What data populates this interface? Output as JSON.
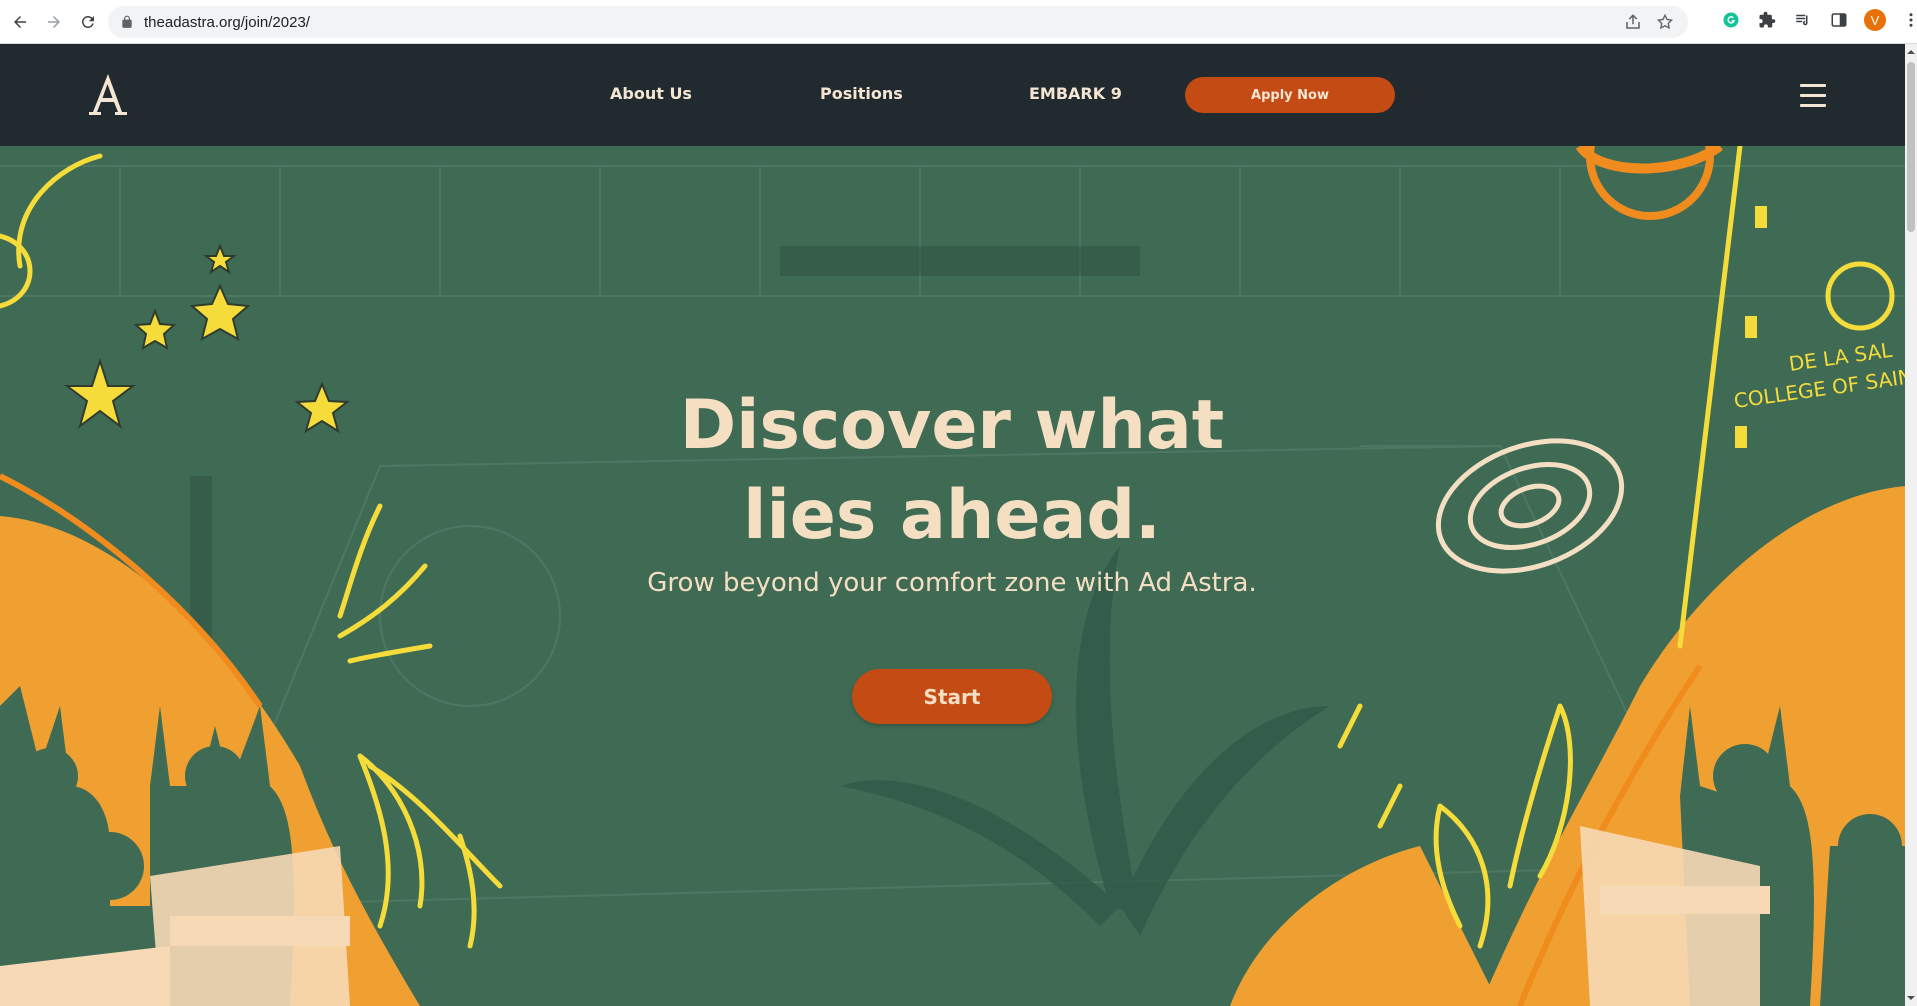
{
  "browser": {
    "url": "theadastra.org/join/2023/",
    "profile_initial": "V",
    "icons": [
      "back-icon",
      "forward-icon",
      "reload-icon",
      "lock-icon",
      "share-icon",
      "bookmark-star-icon",
      "grammarly-icon",
      "extensions-puzzle-icon",
      "media-queue-icon",
      "side-panel-icon",
      "kebab-menu-icon"
    ]
  },
  "site": {
    "logo_letter": "A",
    "nav": {
      "about": "About Us",
      "positions": "Positions",
      "embark": "EMBARK 9",
      "apply": "Apply Now"
    },
    "hero": {
      "title_line1": "Discover what",
      "title_line2": "lies ahead.",
      "subtitle": "Grow beyond your comfort zone with Ad Astra.",
      "cta": "Start",
      "sign_text_1": "DE LA SAL",
      "sign_text_2": "COLLEGE OF SAIN"
    }
  },
  "colors": {
    "header_bg": "#212a2f",
    "hero_green": "#3f6b55",
    "accent_orange": "#c54b14",
    "cream": "#f4dfc3",
    "hill_orange": "#f0a031",
    "doodle_yellow": "#f5dc3a"
  }
}
